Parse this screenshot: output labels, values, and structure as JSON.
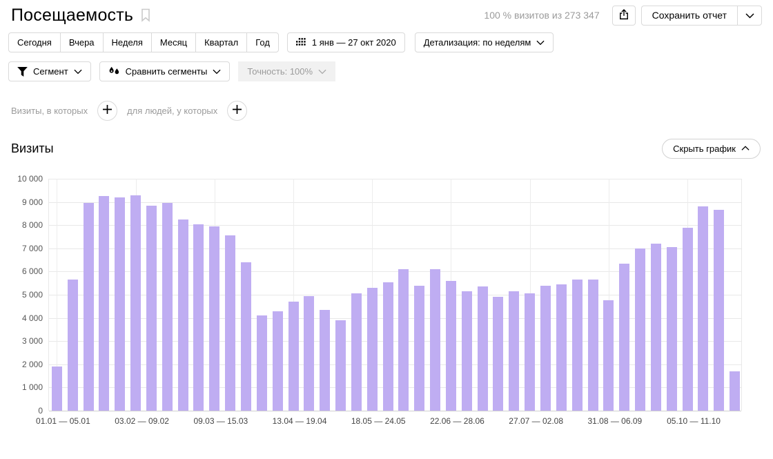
{
  "header": {
    "title": "Посещаемость",
    "visits_summary": "100 % визитов из 273 347",
    "save_report_label": "Сохранить отчет"
  },
  "icons": {
    "bookmark-icon": "outline bookmark flag",
    "share-icon": "box with arrow up (export)",
    "calendar-grid-icon": "grid of dots (date picker)",
    "funnel-icon": "filled filter funnel",
    "segments-drops-icon": "two ink drops",
    "chevron-down-icon": "v",
    "chevron-up-icon": "^",
    "plus-icon": "+"
  },
  "period_tabs": [
    "Сегодня",
    "Вчера",
    "Неделя",
    "Месяц",
    "Квартал",
    "Год"
  ],
  "date_range": "1 янв — 27 окт 2020",
  "detalization_label": "Детализация: по неделям",
  "segment_bar": {
    "segment_label": "Сегмент",
    "compare_label": "Сравнить сегменты",
    "accuracy_label": "Точность: 100%"
  },
  "filters": {
    "visits_label": "Визиты, в которых",
    "people_label": "для людей, у которых"
  },
  "section": {
    "title": "Визиты",
    "hide_chart_label": "Скрыть график"
  },
  "chart_data": {
    "type": "bar",
    "title": "Визиты",
    "bar_color": "#bfadf2",
    "grid": true,
    "ylim": [
      0,
      10000
    ],
    "y_tick_labels": [
      "10 000",
      "9 000",
      "8 000",
      "7 000",
      "6 000",
      "5 000",
      "4 000",
      "3 000",
      "2 000",
      "1 000",
      "0"
    ],
    "x_tick_labels": [
      "01.01 — 05.01",
      "03.02 — 09.02",
      "09.03 — 15.03",
      "13.04 — 19.04",
      "18.05 — 24.05",
      "22.06 — 28.06",
      "27.07 — 02.08",
      "31.08 — 06.09",
      "05.10 — 11.10"
    ],
    "x_tick_bar_indices": [
      0,
      5,
      10,
      15,
      20,
      25,
      30,
      35,
      40
    ],
    "values": [
      1900,
      5650,
      8950,
      9250,
      9200,
      9300,
      8850,
      8950,
      8250,
      8050,
      7950,
      7550,
      6400,
      4100,
      4300,
      4700,
      4950,
      4350,
      3900,
      5050,
      5300,
      5550,
      6100,
      5400,
      6100,
      5600,
      5150,
      5350,
      4900,
      5150,
      5050,
      5400,
      5450,
      5650,
      5650,
      4750,
      6350,
      7000,
      7200,
      7050,
      7900,
      8800,
      8650,
      1700
    ]
  }
}
